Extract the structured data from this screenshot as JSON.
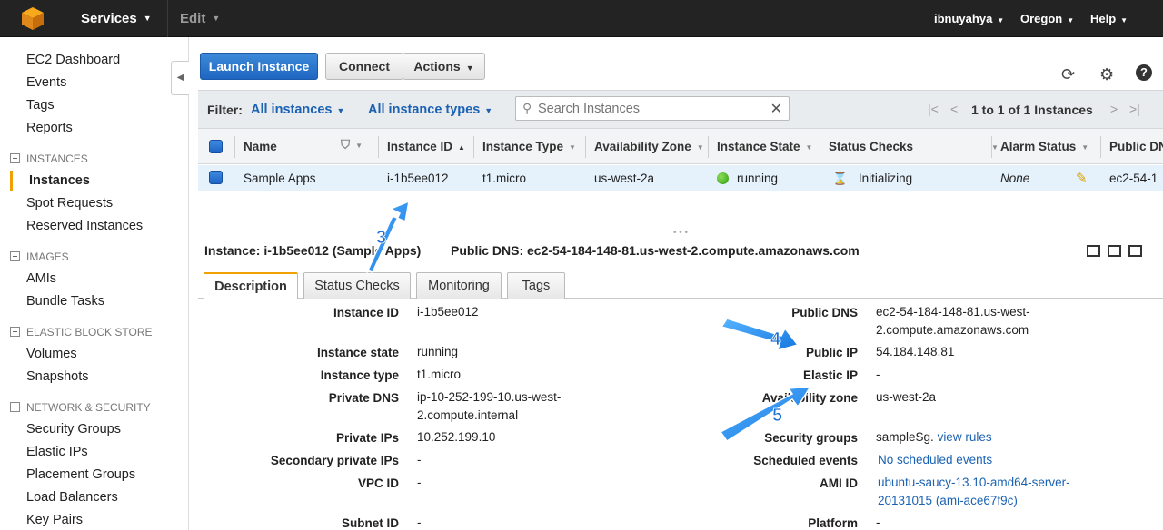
{
  "topnav": {
    "services": "Services",
    "edit": "Edit",
    "user": "ibnuyahya",
    "region": "Oregon",
    "help": "Help"
  },
  "sidebar": {
    "items": [
      {
        "label": "EC2 Dashboard"
      },
      {
        "label": "Events"
      },
      {
        "label": "Tags"
      },
      {
        "label": "Reports"
      }
    ],
    "sections": [
      {
        "title": "INSTANCES",
        "items": [
          "Instances",
          "Spot Requests",
          "Reserved Instances"
        ]
      },
      {
        "title": "IMAGES",
        "items": [
          "AMIs",
          "Bundle Tasks"
        ]
      },
      {
        "title": "ELASTIC BLOCK STORE",
        "items": [
          "Volumes",
          "Snapshots"
        ]
      },
      {
        "title": "NETWORK & SECURITY",
        "items": [
          "Security Groups",
          "Elastic IPs",
          "Placement Groups",
          "Load Balancers",
          "Key Pairs"
        ]
      }
    ],
    "active": "Instances"
  },
  "toolbar": {
    "launch": "Launch Instance",
    "connect": "Connect",
    "actions": "Actions"
  },
  "filter": {
    "label": "Filter:",
    "instances": "All instances",
    "types": "All instance types",
    "search_placeholder": "Search Instances",
    "page_text": "1 to 1 of 1 Instances"
  },
  "table": {
    "headers": [
      "Name",
      "Instance ID",
      "Instance Type",
      "Availability Zone",
      "Instance State",
      "Status Checks",
      "Alarm Status",
      "Public DNS"
    ],
    "row": {
      "name": "Sample Apps",
      "id": "i-1b5ee012",
      "type": "t1.micro",
      "az": "us-west-2a",
      "state": "running",
      "checks": "Initializing",
      "alarm": "None",
      "dns": "ec2-54-1"
    }
  },
  "detail": {
    "instance_label": "Instance: i-1b5ee012 (Sample Apps)",
    "dns_label": "Public DNS: ec2-54-184-148-81.us-west-2.compute.amazonaws.com",
    "tabs": [
      "Description",
      "Status Checks",
      "Monitoring",
      "Tags"
    ],
    "left": [
      {
        "k": "Instance ID",
        "v": "i-1b5ee012"
      },
      {
        "k": "Instance state",
        "v": "running"
      },
      {
        "k": "Instance type",
        "v": "t1.micro"
      },
      {
        "k": "Private DNS",
        "v1": "ip-10-252-199-10.us-west-",
        "v2": "2.compute.internal"
      },
      {
        "k": "Private IPs",
        "v": "10.252.199.10"
      },
      {
        "k": "Secondary private IPs",
        "v": "-"
      },
      {
        "k": "VPC ID",
        "v": "-"
      },
      {
        "k": "Subnet ID",
        "v": "-"
      }
    ],
    "right": [
      {
        "k": "Public DNS",
        "v1": "ec2-54-184-148-81.us-west-",
        "v2": "2.compute.amazonaws.com"
      },
      {
        "k": "Public IP",
        "v": "54.184.148.81"
      },
      {
        "k": "Elastic IP",
        "v": "-"
      },
      {
        "k": "Availability zone",
        "v": "us-west-2a"
      },
      {
        "k": "Security groups",
        "v": "sampleSg.",
        "link": "view rules"
      },
      {
        "k": "Scheduled events",
        "link": "No scheduled events"
      },
      {
        "k": "AMI ID",
        "link1": "ubuntu-saucy-13.10-amd64-server-",
        "link2": "20131015 (ami-ace67f9c)"
      },
      {
        "k": "Platform",
        "v": "-"
      }
    ]
  },
  "annotations": {
    "a3": "3",
    "a4": "4",
    "a5": "5"
  },
  "colors": {
    "nav_bg": "#232323",
    "primary": "#1f66c2",
    "accent": "#f0a000",
    "arrow": "#2a8ff0"
  }
}
